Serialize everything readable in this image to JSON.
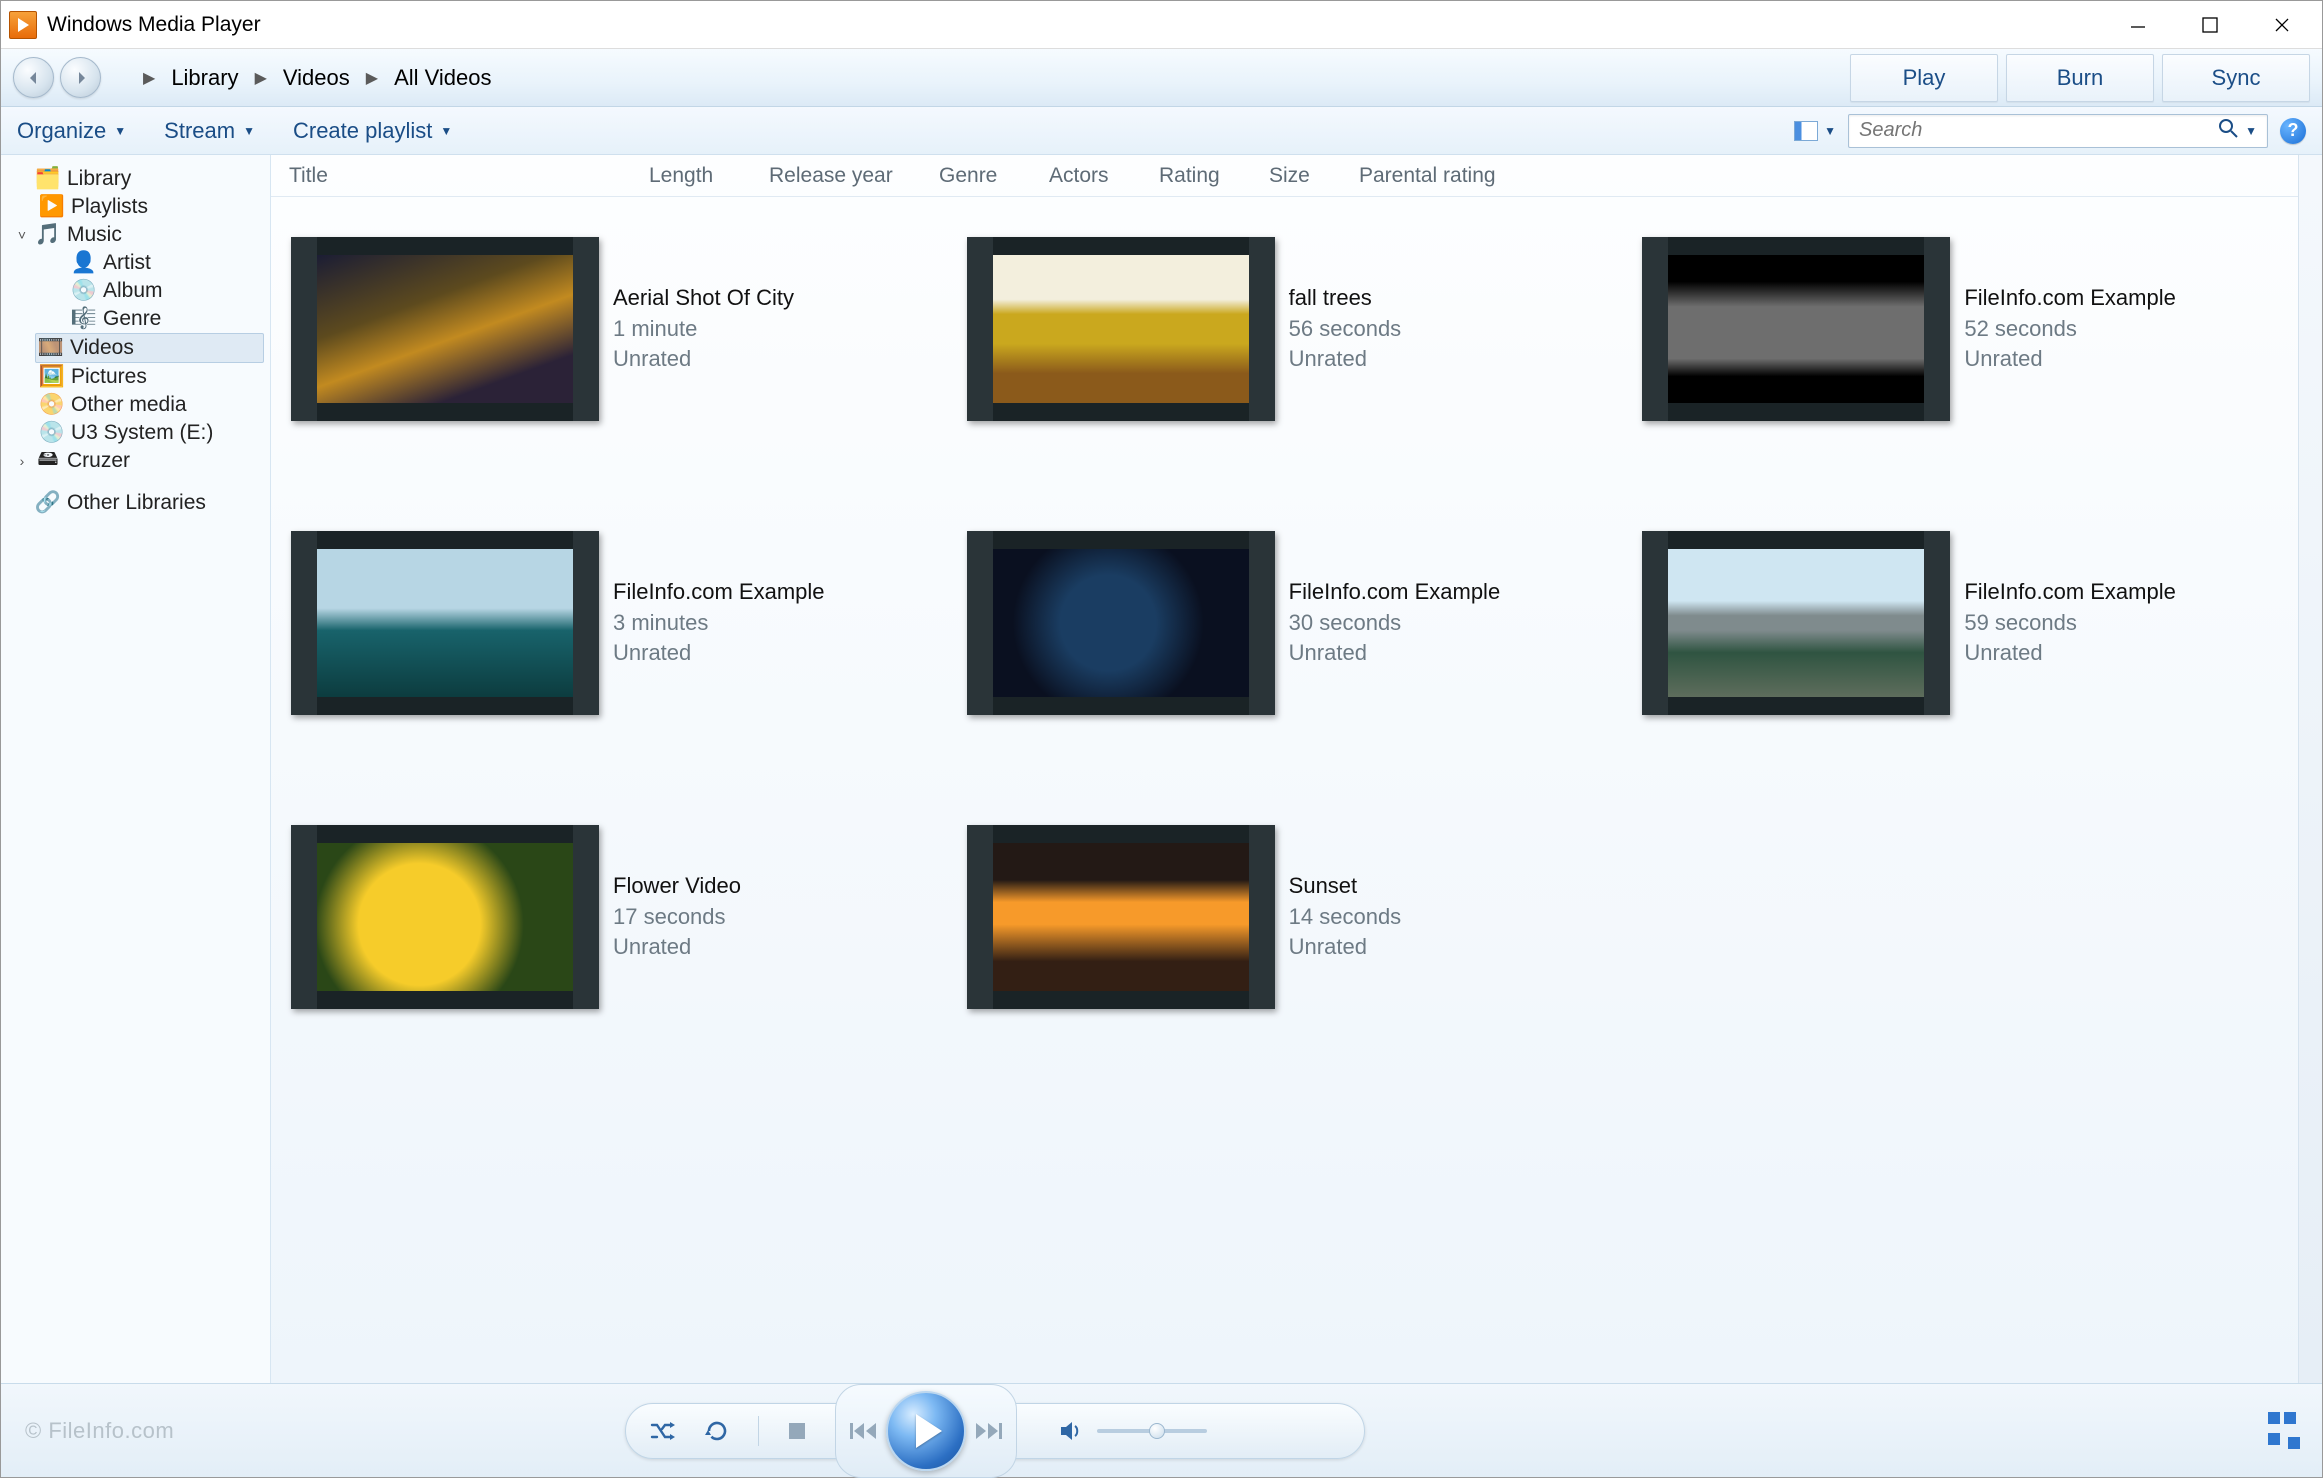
{
  "window": {
    "title": "Windows Media Player"
  },
  "breadcrumb": {
    "a": "Library",
    "b": "Videos",
    "c": "All Videos"
  },
  "modeTabs": {
    "play": "Play",
    "burn": "Burn",
    "sync": "Sync"
  },
  "toolbar": {
    "organize": "Organize",
    "stream": "Stream",
    "createPlaylist": "Create playlist"
  },
  "search": {
    "placeholder": "Search"
  },
  "tree": {
    "library": "Library",
    "playlists": "Playlists",
    "music": "Music",
    "artist": "Artist",
    "album": "Album",
    "genre": "Genre",
    "videos": "Videos",
    "pictures": "Pictures",
    "otherMedia": "Other media",
    "u3": "U3 System (E:)",
    "cruzer": "Cruzer",
    "otherLibs": "Other Libraries"
  },
  "columns": {
    "title": "Title",
    "length": "Length",
    "releaseYear": "Release year",
    "genre": "Genre",
    "actors": "Actors",
    "rating": "Rating",
    "size": "Size",
    "parental": "Parental rating"
  },
  "videos": [
    {
      "title": "Aerial Shot Of City",
      "length": "1 minute",
      "rating": "Unrated",
      "art": "art-city"
    },
    {
      "title": "fall trees",
      "length": "56 seconds",
      "rating": "Unrated",
      "art": "art-trees"
    },
    {
      "title": "FileInfo.com Example",
      "length": "52 seconds",
      "rating": "Unrated",
      "art": "art-gray"
    },
    {
      "title": "FileInfo.com Example",
      "length": "3 minutes",
      "rating": "Unrated",
      "art": "art-sea"
    },
    {
      "title": "FileInfo.com Example",
      "length": "30 seconds",
      "rating": "Unrated",
      "art": "art-earth"
    },
    {
      "title": "FileInfo.com Example",
      "length": "59 seconds",
      "rating": "Unrated",
      "art": "art-mtn"
    },
    {
      "title": "Flower Video",
      "length": "17 seconds",
      "rating": "Unrated",
      "art": "art-flower"
    },
    {
      "title": "Sunset",
      "length": "14 seconds",
      "rating": "Unrated",
      "art": "art-sunset"
    }
  ],
  "watermark": "© FileInfo.com"
}
